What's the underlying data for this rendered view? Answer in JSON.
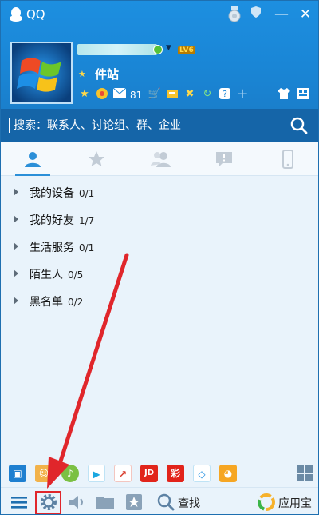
{
  "window": {
    "title": "QQ"
  },
  "profile": {
    "level_badge": "LV6",
    "signature": "件站",
    "mail_count": "81"
  },
  "search": {
    "placeholder": "搜索：联系人、讨论组、群、企业"
  },
  "tabs": [
    {
      "name": "contacts",
      "icon": "person-icon",
      "active": true
    },
    {
      "name": "favorites",
      "icon": "star-icon",
      "active": false
    },
    {
      "name": "groups",
      "icon": "group-icon",
      "active": false
    },
    {
      "name": "messages",
      "icon": "chat-icon",
      "active": false
    },
    {
      "name": "devices",
      "icon": "phone-icon",
      "active": false
    }
  ],
  "groups": [
    {
      "label": "我的设备",
      "count": "0/1"
    },
    {
      "label": "我的好友",
      "count": "1/7"
    },
    {
      "label": "生活服务",
      "count": "0/1"
    },
    {
      "label": "陌生人",
      "count": "0/5"
    },
    {
      "label": "黑名单",
      "count": "0/2"
    }
  ],
  "toolbar": {
    "find_label": "查找",
    "appstore_label": "应用宝"
  },
  "colors": {
    "header": "#1a86d6",
    "search_bar": "#1565a8",
    "panel": "#e9f3fb",
    "annotation": "#e0262b"
  }
}
